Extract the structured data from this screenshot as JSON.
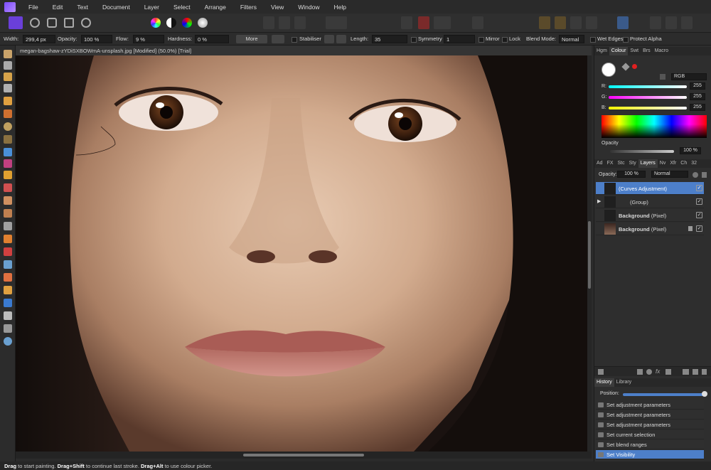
{
  "menu": [
    "File",
    "Edit",
    "Text",
    "Document",
    "Layer",
    "Select",
    "Arrange",
    "Filters",
    "View",
    "Window",
    "Help"
  ],
  "context": {
    "width_label": "Width:",
    "width_value": "299,4 px",
    "opacity_label": "Opacity:",
    "opacity_value": "100 %",
    "flow_label": "Flow:",
    "flow_value": "9 %",
    "hardness_label": "Hardness:",
    "hardness_value": "0 %",
    "more_label": "More",
    "stabiliser_label": "Stabiliser",
    "length_label": "Length:",
    "length_value": "35",
    "symmetry_label": "Symmetry",
    "symmetry_value": "1",
    "mirror_label": "Mirror",
    "lock_label": "Lock",
    "blend_label": "Blend Mode:",
    "blend_value": "Normal",
    "wet_edges_label": "Wet Edges",
    "protect_alpha_label": "Protect Alpha"
  },
  "document": {
    "tab_title": "megan-bagshaw-zYDiSXBOWmA-unsplash.jpg [Modified] (50.0%) [Trial]"
  },
  "colour_panel": {
    "tabs": [
      "Hgm",
      "Colour",
      "Swt",
      "Brs",
      "Macro"
    ],
    "active_tab": "Colour",
    "model": "RGB",
    "r_label": "R:",
    "r_value": "255",
    "g_label": "G:",
    "g_value": "255",
    "b_label": "B:",
    "b_value": "255",
    "opacity_label": "Opacity",
    "opacity_value": "100 %"
  },
  "layers_panel": {
    "tabs": [
      "Ad",
      "FX",
      "Stc",
      "Sty",
      "Layers",
      "Nv",
      "Xfr",
      "Ch",
      "32"
    ],
    "active_tab": "Layers",
    "opacity_label": "Opacity:",
    "opacity_value": "100 %",
    "blend_value": "Normal",
    "layers": [
      {
        "name": "(Curves Adjustment)",
        "selected": true
      },
      {
        "name": "(Group)",
        "selected": false
      },
      {
        "name": "Background",
        "suffix": "(Pixel)",
        "selected": false
      },
      {
        "name": "Background",
        "suffix": "(Pixel)",
        "selected": false
      }
    ]
  },
  "history_panel": {
    "tabs": [
      "History",
      "Library"
    ],
    "active_tab": "History",
    "position_label": "Position:",
    "position_fraction": 1.0,
    "items": [
      "Set adjustment parameters",
      "Set adjustment parameters",
      "Set adjustment parameters",
      "Set current selection",
      "Set blend ranges",
      "Set Visibility"
    ]
  },
  "status": {
    "k1": "Drag",
    "t1": " to start painting. ",
    "k2": "Drag+Shift",
    "t2": " to continue last stroke. ",
    "k3": "Drag+Alt",
    "t3": " to use colour picker."
  },
  "colors": {
    "accent": "#4d7fc9",
    "brand": "#7c4dff"
  }
}
